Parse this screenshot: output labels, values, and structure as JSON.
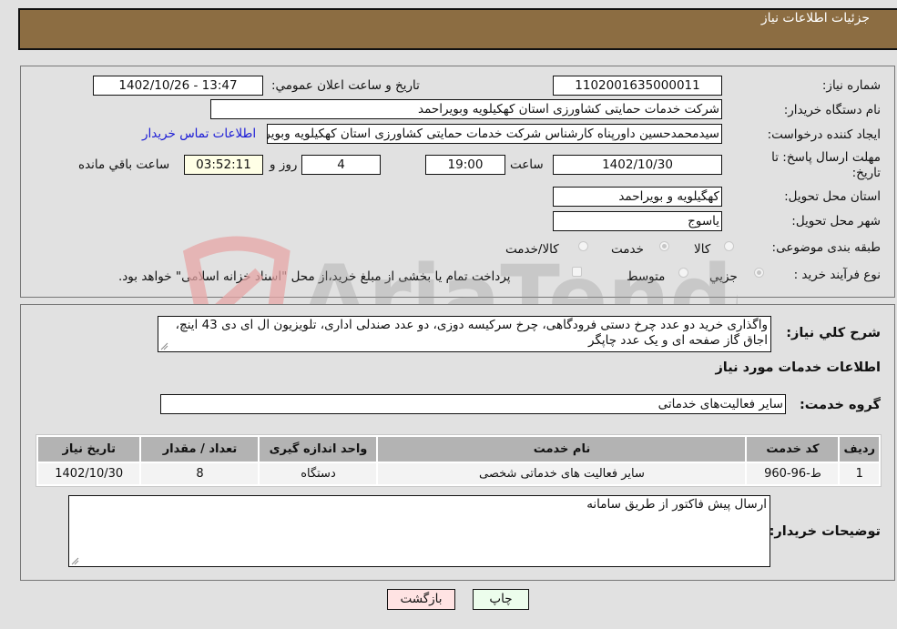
{
  "header": {
    "title": "جزئیات اطلاعات نیاز"
  },
  "form": {
    "need_number": {
      "label": "شماره نیاز:",
      "value": "1102001635000011"
    },
    "announce_datetime": {
      "label": "تاریخ و ساعت اعلان عمومي:",
      "value": "1402/10/26 - 13:47"
    },
    "buyer_org": {
      "label": "نام دستگاه خريدار:",
      "value": "شرکت خدمات حمایتی کشاورزی استان کهکیلویه وبویراحمد"
    },
    "requester": {
      "label": "ایجاد کننده درخواست:",
      "value": "سیدمحمدحسین داورپناه کارشناس شرکت خدمات حمایتی کشاورزی استان کهکیلویه وبویراحمد",
      "contact_link": "اطلاعات تماس خریدار"
    },
    "deadline": {
      "label_line1": "مهلت ارسال پاسخ: تا",
      "label_line2": "تاریخ:",
      "date": "1402/10/30",
      "time_label": "ساعت",
      "time": "19:00",
      "days": "4",
      "days_label": "روز و",
      "remaining": "03:52:11",
      "remaining_label": "ساعت باقي مانده"
    },
    "province": {
      "label": "استان محل تحویل:",
      "value": "کهگیلویه و بویراحمد"
    },
    "city": {
      "label": "شهر محل تحویل:",
      "value": "یاسوج"
    },
    "category": {
      "label": "طبقه بندی موضوعی:",
      "options": [
        {
          "label": "کالا",
          "selected": false
        },
        {
          "label": "خدمت",
          "selected": true
        },
        {
          "label": "کالا/خدمت",
          "selected": false
        }
      ]
    },
    "purchase_type": {
      "label": "نوع فرآیند خرید :",
      "options": [
        {
          "label": "جزيي",
          "selected": true
        },
        {
          "label": "متوسط",
          "selected": false
        }
      ],
      "payment_checkbox_label": "پرداخت تمام یا بخشی از مبلغ خرید،از محل \"اسناد خزانه اسلامی\" خواهد بود.",
      "payment_checked": false
    }
  },
  "details": {
    "summary_label": "شرح کلي نياز:",
    "summary_text": "واگذاری خرید دو عدد چرخ دستی فرودگاهی، چرخ سرکیسه دوزی، دو عدد صندلی اداری، تلویزیون ال ای دی 43 اینچ،  اجاق گاز صفحه ای و یک عدد چاپگر",
    "services_heading": "اطلاعات خدمات مورد نياز",
    "service_group_label": "گروه خدمت:",
    "service_group_value": "سایر فعالیت‌های خدماتی",
    "table": {
      "headers": [
        "ردیف",
        "کد خدمت",
        "نام خدمت",
        "واحد اندازه گیری",
        "تعداد / مقدار",
        "تاریخ نیاز"
      ],
      "rows": [
        [
          "1",
          "ط-96-960",
          "سایر فعالیت های خدماتی شخصی",
          "دستگاه",
          "8",
          "1402/10/30"
        ]
      ]
    },
    "buyer_notes_label": "توضیحات خریدار:",
    "buyer_notes_text": "ارسال پیش فاکتور از طریق سامانه"
  },
  "buttons": {
    "print": "چاپ",
    "back": "بازگشت"
  },
  "watermark": {
    "text": "AriaTender.neT"
  },
  "colors": {
    "header": "#8c6d42",
    "link": "#1a1ad6",
    "print_bg": "#ecfdec",
    "back_bg": "#ffe3e3",
    "remaining_bg": "#ffffe6"
  }
}
